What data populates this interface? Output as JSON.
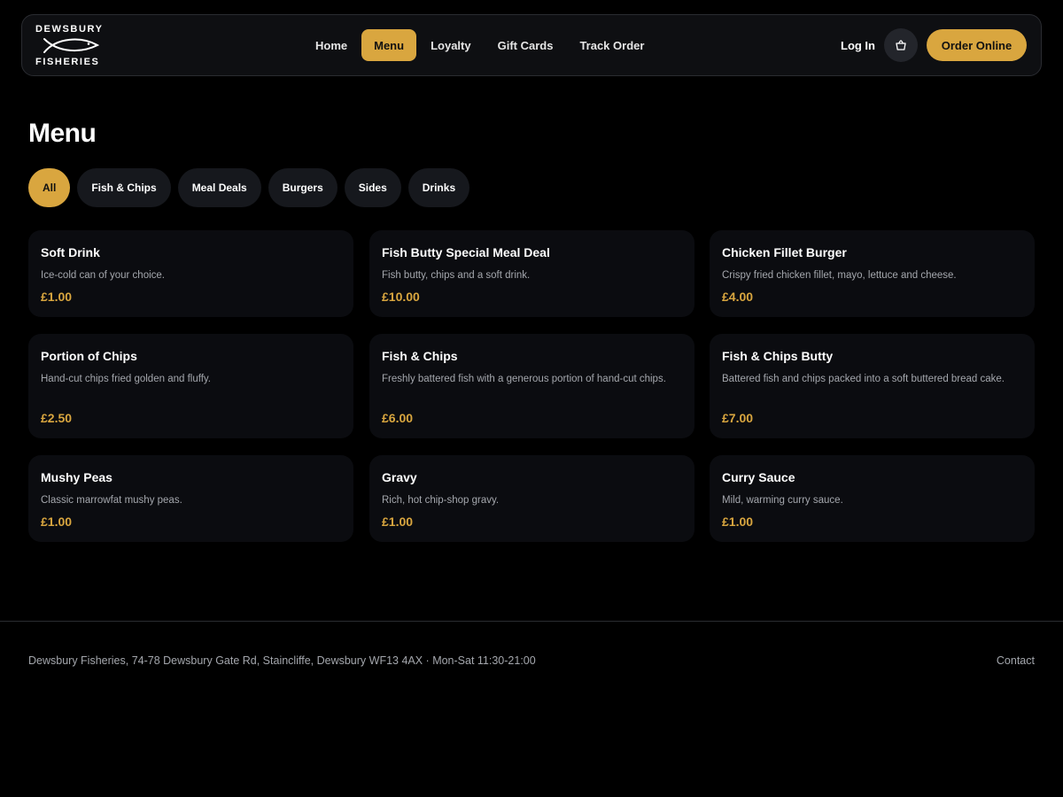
{
  "header": {
    "logo_top": "DEWSBURY",
    "logo_bottom": "FISHERIES",
    "nav": [
      {
        "label": "Home"
      },
      {
        "label": "Menu",
        "active": true
      },
      {
        "label": "Loyalty"
      },
      {
        "label": "Gift Cards"
      },
      {
        "label": "Track Order"
      }
    ],
    "login_label": "Log In",
    "cart_icon": "basket-icon",
    "order_label": "Order Online"
  },
  "page": {
    "title": "Menu"
  },
  "filters": [
    {
      "label": "All",
      "active": true
    },
    {
      "label": "Fish & Chips"
    },
    {
      "label": "Meal Deals"
    },
    {
      "label": "Burgers"
    },
    {
      "label": "Sides"
    },
    {
      "label": "Drinks"
    }
  ],
  "items": [
    {
      "name": "Soft Drink",
      "desc": "Ice-cold can of your choice.",
      "price": "£1.00"
    },
    {
      "name": "Fish Butty Special Meal Deal",
      "desc": "Fish butty, chips and a soft drink.",
      "price": "£10.00"
    },
    {
      "name": "Chicken Fillet Burger",
      "desc": "Crispy fried chicken fillet, mayo, lettuce and cheese.",
      "price": "£4.00"
    },
    {
      "name": "Portion of Chips",
      "desc": "Hand-cut chips fried golden and fluffy.",
      "price": "£2.50"
    },
    {
      "name": "Fish & Chips",
      "desc": "Freshly battered fish with a generous portion of hand-cut chips.",
      "price": "£6.00"
    },
    {
      "name": "Fish & Chips Butty",
      "desc": "Battered fish and chips packed into a soft buttered bread cake.",
      "price": "£7.00"
    },
    {
      "name": "Mushy Peas",
      "desc": "Classic marrowfat mushy peas.",
      "price": "£1.00"
    },
    {
      "name": "Gravy",
      "desc": "Rich, hot chip-shop gravy.",
      "price": "£1.00"
    },
    {
      "name": "Curry Sauce",
      "desc": "Mild, warming curry sauce.",
      "price": "£1.00"
    }
  ],
  "footer": {
    "info": "Dewsbury Fisheries, 74-78 Dewsbury Gate Rd, Staincliffe, Dewsbury WF13 4AX · Mon-Sat 11:30-21:00",
    "contact": "Contact"
  },
  "colors": {
    "accent": "#d9a63f",
    "background": "#000000",
    "card": "#0b0c10"
  }
}
